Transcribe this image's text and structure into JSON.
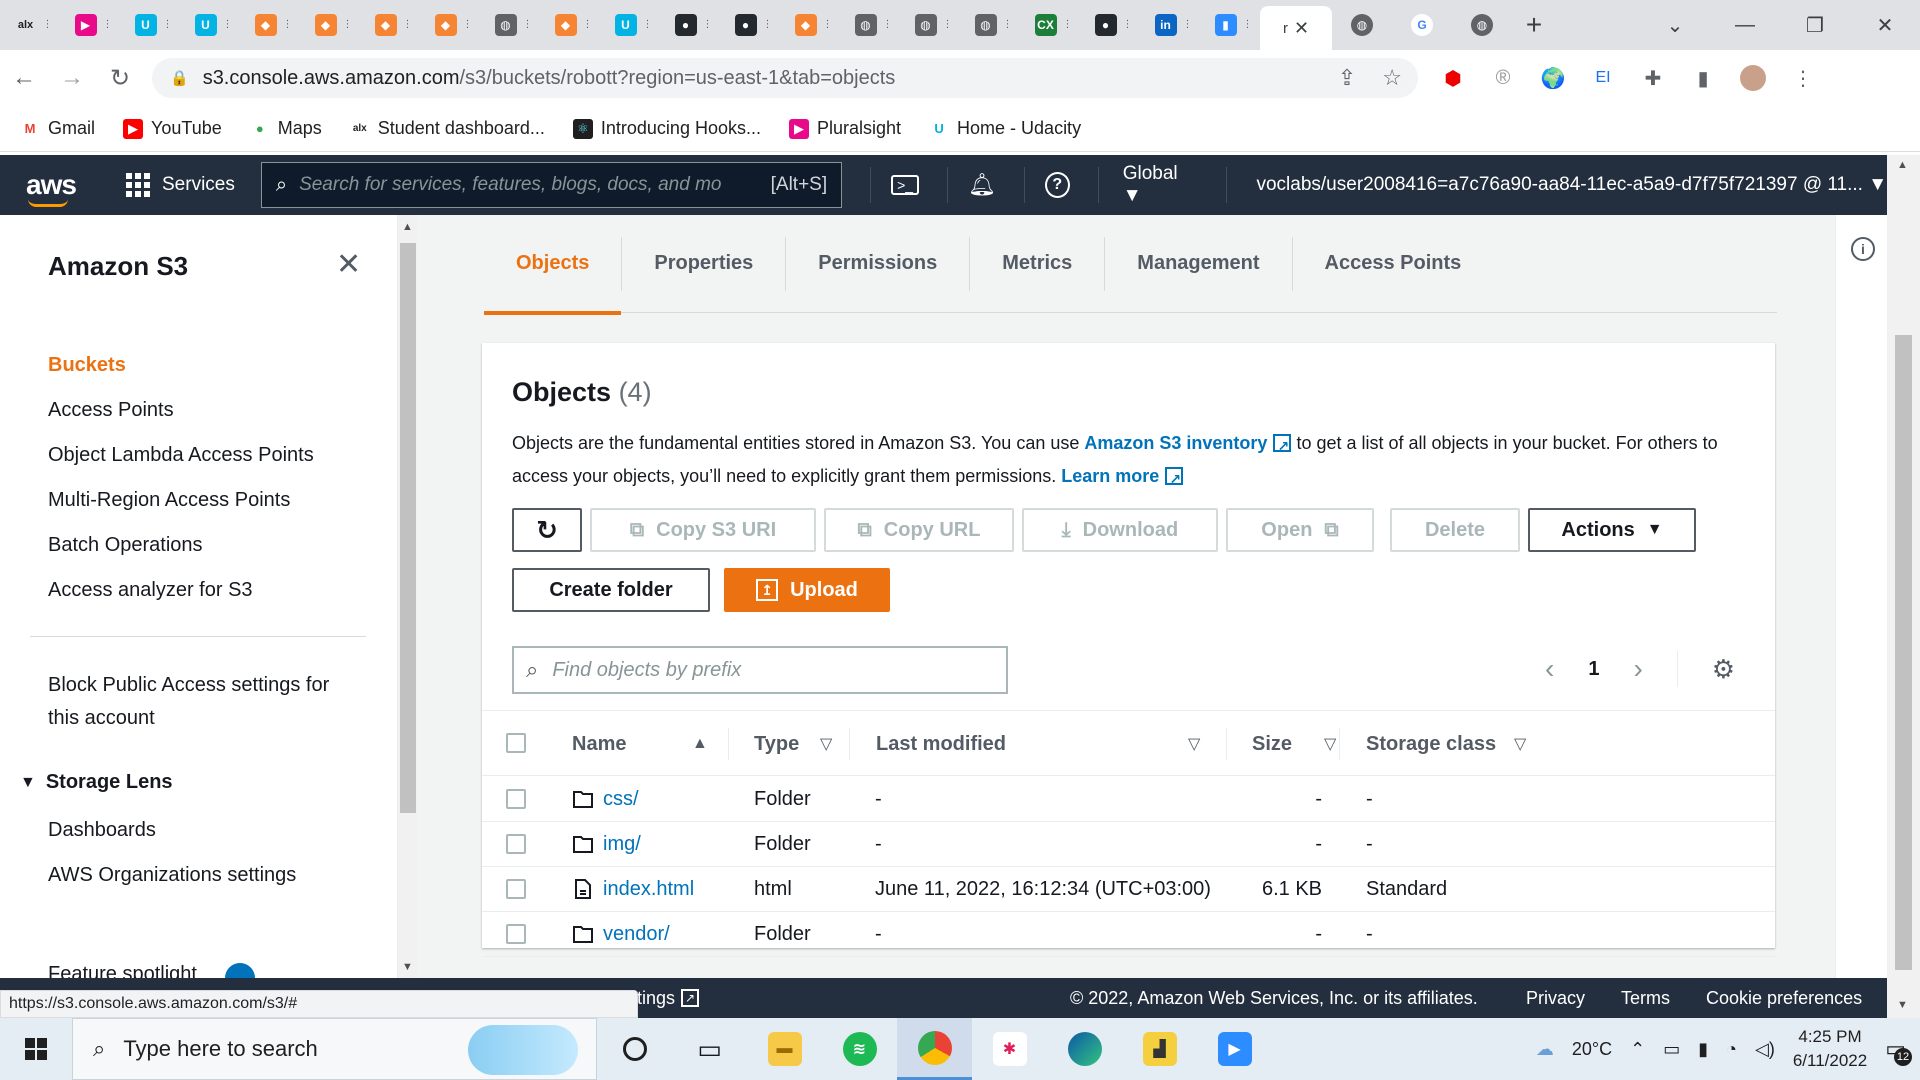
{
  "browser": {
    "tabs": [
      {
        "icon": "alx",
        "color": "#1f1f1f"
      },
      {
        "icon": "pluralsight",
        "color": "#e80a89"
      },
      {
        "icon": "udacity",
        "color": "#02b3e4"
      },
      {
        "icon": "udacity",
        "color": "#02b3e4"
      },
      {
        "icon": "aws-cube",
        "color": "#f58534"
      },
      {
        "icon": "aws-cube",
        "color": "#f58534"
      },
      {
        "icon": "aws-cube",
        "color": "#f58534"
      },
      {
        "icon": "aws-cube",
        "color": "#f58534"
      },
      {
        "icon": "globe",
        "color": "#5f6368"
      },
      {
        "icon": "aws-cube",
        "color": "#f58534"
      },
      {
        "icon": "udacity",
        "color": "#02b3e4"
      },
      {
        "icon": "github",
        "color": "#24292f"
      },
      {
        "icon": "github",
        "color": "#24292f"
      },
      {
        "icon": "aws-cube",
        "color": "#f58534"
      },
      {
        "icon": "globe",
        "color": "#5f6368"
      },
      {
        "icon": "globe",
        "color": "#5f6368"
      },
      {
        "icon": "globe",
        "color": "#5f6368"
      },
      {
        "icon": "cx",
        "color": "#1b7f3a"
      },
      {
        "icon": "github",
        "color": "#24292f"
      },
      {
        "icon": "linkedin",
        "color": "#0a66c2"
      },
      {
        "icon": "zoom",
        "color": "#2d8cff"
      }
    ],
    "active_tab_label": "r",
    "url_host": "s3.console.aws.amazon.com",
    "url_path": "/s3/buckets/robott?region=us-east-1&tab=objects",
    "bookmarks": [
      {
        "label": "Gmail",
        "icon": "gmail-icon"
      },
      {
        "label": "YouTube",
        "icon": "youtube-icon"
      },
      {
        "label": "Maps",
        "icon": "maps-icon"
      },
      {
        "label": "Student dashboard...",
        "icon": "alx-icon"
      },
      {
        "label": "Introducing Hooks...",
        "icon": "react-icon"
      },
      {
        "label": "Pluralsight",
        "icon": "pluralsight-icon"
      },
      {
        "label": "Home - Udacity",
        "icon": "udacity-icon"
      }
    ],
    "status_url": "https://s3.console.aws.amazon.com/s3/#"
  },
  "aws_nav": {
    "logo": "aws",
    "services": "Services",
    "search_placeholder": "Search for services, features, blogs, docs, and mo",
    "search_shortcut": "[Alt+S]",
    "region": "Global ▼",
    "account": "voclabs/user2008416=a7c76a90-aa84-11ec-a5a9-d7f75f721397 @ 11... ▼"
  },
  "sidebar": {
    "title": "Amazon S3",
    "items": [
      "Buckets",
      "Access Points",
      "Object Lambda Access Points",
      "Multi-Region Access Points",
      "Batch Operations",
      "Access analyzer for S3"
    ],
    "block_public": "Block Public Access settings for this account",
    "storage_lens": "Storage Lens",
    "lens_items": [
      "Dashboards",
      "AWS Organizations settings"
    ],
    "cut_item": "Feature spotlight"
  },
  "tabs": [
    "Objects",
    "Properties",
    "Permissions",
    "Metrics",
    "Management",
    "Access Points"
  ],
  "objects": {
    "title": "Objects",
    "count": "(4)",
    "desc_1": "Objects are the fundamental entities stored in Amazon S3. You can use",
    "desc_link1": "Amazon S3 inventory",
    "desc_2": "to get a list of all objects in your bucket. For others to access your objects, you’ll need to explicitly grant them permissions.",
    "desc_link2": "Learn more",
    "buttons": {
      "copy_uri": "Copy S3 URI",
      "copy_url": "Copy URL",
      "download": "Download",
      "open": "Open",
      "delete": "Delete",
      "actions": "Actions",
      "create_folder": "Create folder",
      "upload": "Upload"
    },
    "search_placeholder": "Find objects by prefix",
    "page": "1",
    "columns": [
      "Name",
      "Type",
      "Last modified",
      "Size",
      "Storage class"
    ],
    "rows": [
      {
        "name": "css/",
        "type": "Folder",
        "modified": "-",
        "size": "-",
        "class": "-",
        "kind": "folder"
      },
      {
        "name": "img/",
        "type": "Folder",
        "modified": "-",
        "size": "-",
        "class": "-",
        "kind": "folder"
      },
      {
        "name": "index.html",
        "type": "html",
        "modified": "June 11, 2022, 16:12:34 (UTC+03:00)",
        "size": "6.1 KB",
        "class": "Standard",
        "kind": "file"
      },
      {
        "name": "vendor/",
        "type": "Folder",
        "modified": "-",
        "size": "-",
        "class": "-",
        "kind": "folder"
      }
    ]
  },
  "footer": {
    "feedback": "ttings",
    "copyright": "© 2022, Amazon Web Services, Inc. or its affiliates.",
    "links": [
      "Privacy",
      "Terms",
      "Cookie preferences"
    ]
  },
  "taskbar": {
    "search_placeholder": "Type here to search",
    "weather": "20°C",
    "time": "4:25 PM",
    "date": "6/11/2022",
    "notifications": "12"
  }
}
